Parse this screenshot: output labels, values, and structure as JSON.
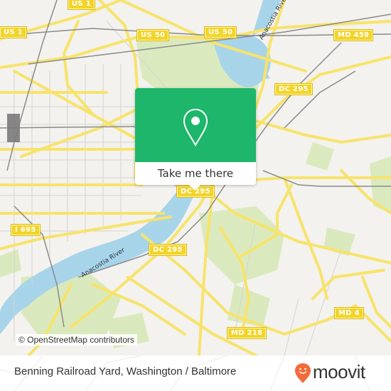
{
  "map": {
    "road_shields": [
      {
        "label": "US 1",
        "pos": "top-left"
      },
      {
        "label": "US 1",
        "pos": "top"
      },
      {
        "label": "US 50",
        "pos": "top-center-left"
      },
      {
        "label": "US 50",
        "pos": "top-center"
      },
      {
        "label": "MD 459",
        "pos": "top-right"
      },
      {
        "label": "DC 295",
        "pos": "upper-right"
      },
      {
        "label": "DC 295",
        "pos": "center"
      },
      {
        "label": "I 695",
        "pos": "left"
      },
      {
        "label": "DC 295",
        "pos": "lower-center"
      },
      {
        "label": "MD 4",
        "pos": "lower-right"
      },
      {
        "label": "MD 218",
        "pos": "bottom-center"
      }
    ],
    "river_labels": [
      "Anacostia River",
      "Anacostia River"
    ],
    "attribution": "© OpenStreetMap contributors",
    "colors": {
      "land": "#f3f2ee",
      "road": "#f7e36b",
      "water": "#a8d4ea",
      "park": "#d8e9b8",
      "rail": "#888888"
    }
  },
  "popup": {
    "icon": "location-pin-icon",
    "button_label": "Take me there",
    "color": "#1db66a"
  },
  "footer": {
    "location_title": "Benning Railroad Yard, Washington / Baltimore",
    "brand": "moovit",
    "brand_color": "#f26b3a"
  }
}
